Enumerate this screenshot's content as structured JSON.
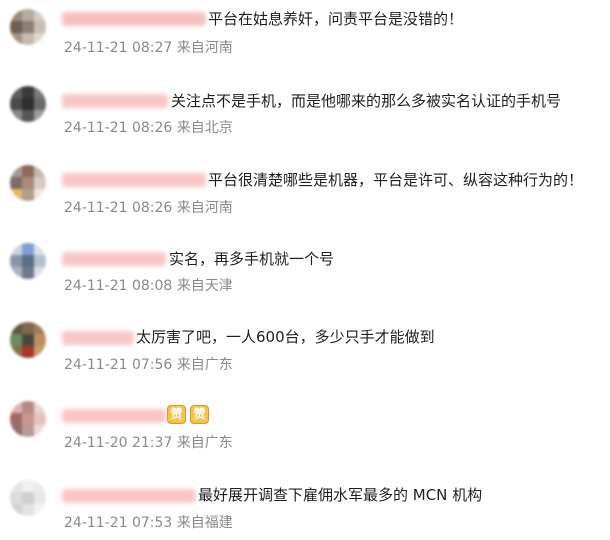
{
  "comments": [
    {
      "text": "平台在姑息养奸，问责平台是没错的！",
      "time": "24-11-21 08:27",
      "location": "来自河南"
    },
    {
      "text": "关注点不是手机，而是他哪来的那么多被实名认证的手机号",
      "time": "24-11-21 08:26",
      "location": "来自北京"
    },
    {
      "text": "平台很清楚哪些是机器，平台是许可、纵容这种行为的！",
      "time": "24-11-21 08:26",
      "location": "来自河南"
    },
    {
      "text": "实名，再多手机就一个号",
      "time": "24-11-21 08:08",
      "location": "来自天津"
    },
    {
      "text": "太厉害了吧，一人600台，多少只手才能做到",
      "time": "24-11-21 07:56",
      "location": "来自广东"
    },
    {
      "text": "",
      "time": "24-11-20 21:37",
      "location": "来自广东",
      "emojis": [
        "赞",
        "赞"
      ]
    },
    {
      "text": "最好展开调查下雇佣水军最多的 MCN 机构",
      "time": "24-11-21 07:53",
      "location": "来自福建"
    }
  ],
  "colors": {
    "text": "#1f1f1f",
    "meta": "#8a8a8a",
    "name_blur": "#f5b8b8"
  }
}
